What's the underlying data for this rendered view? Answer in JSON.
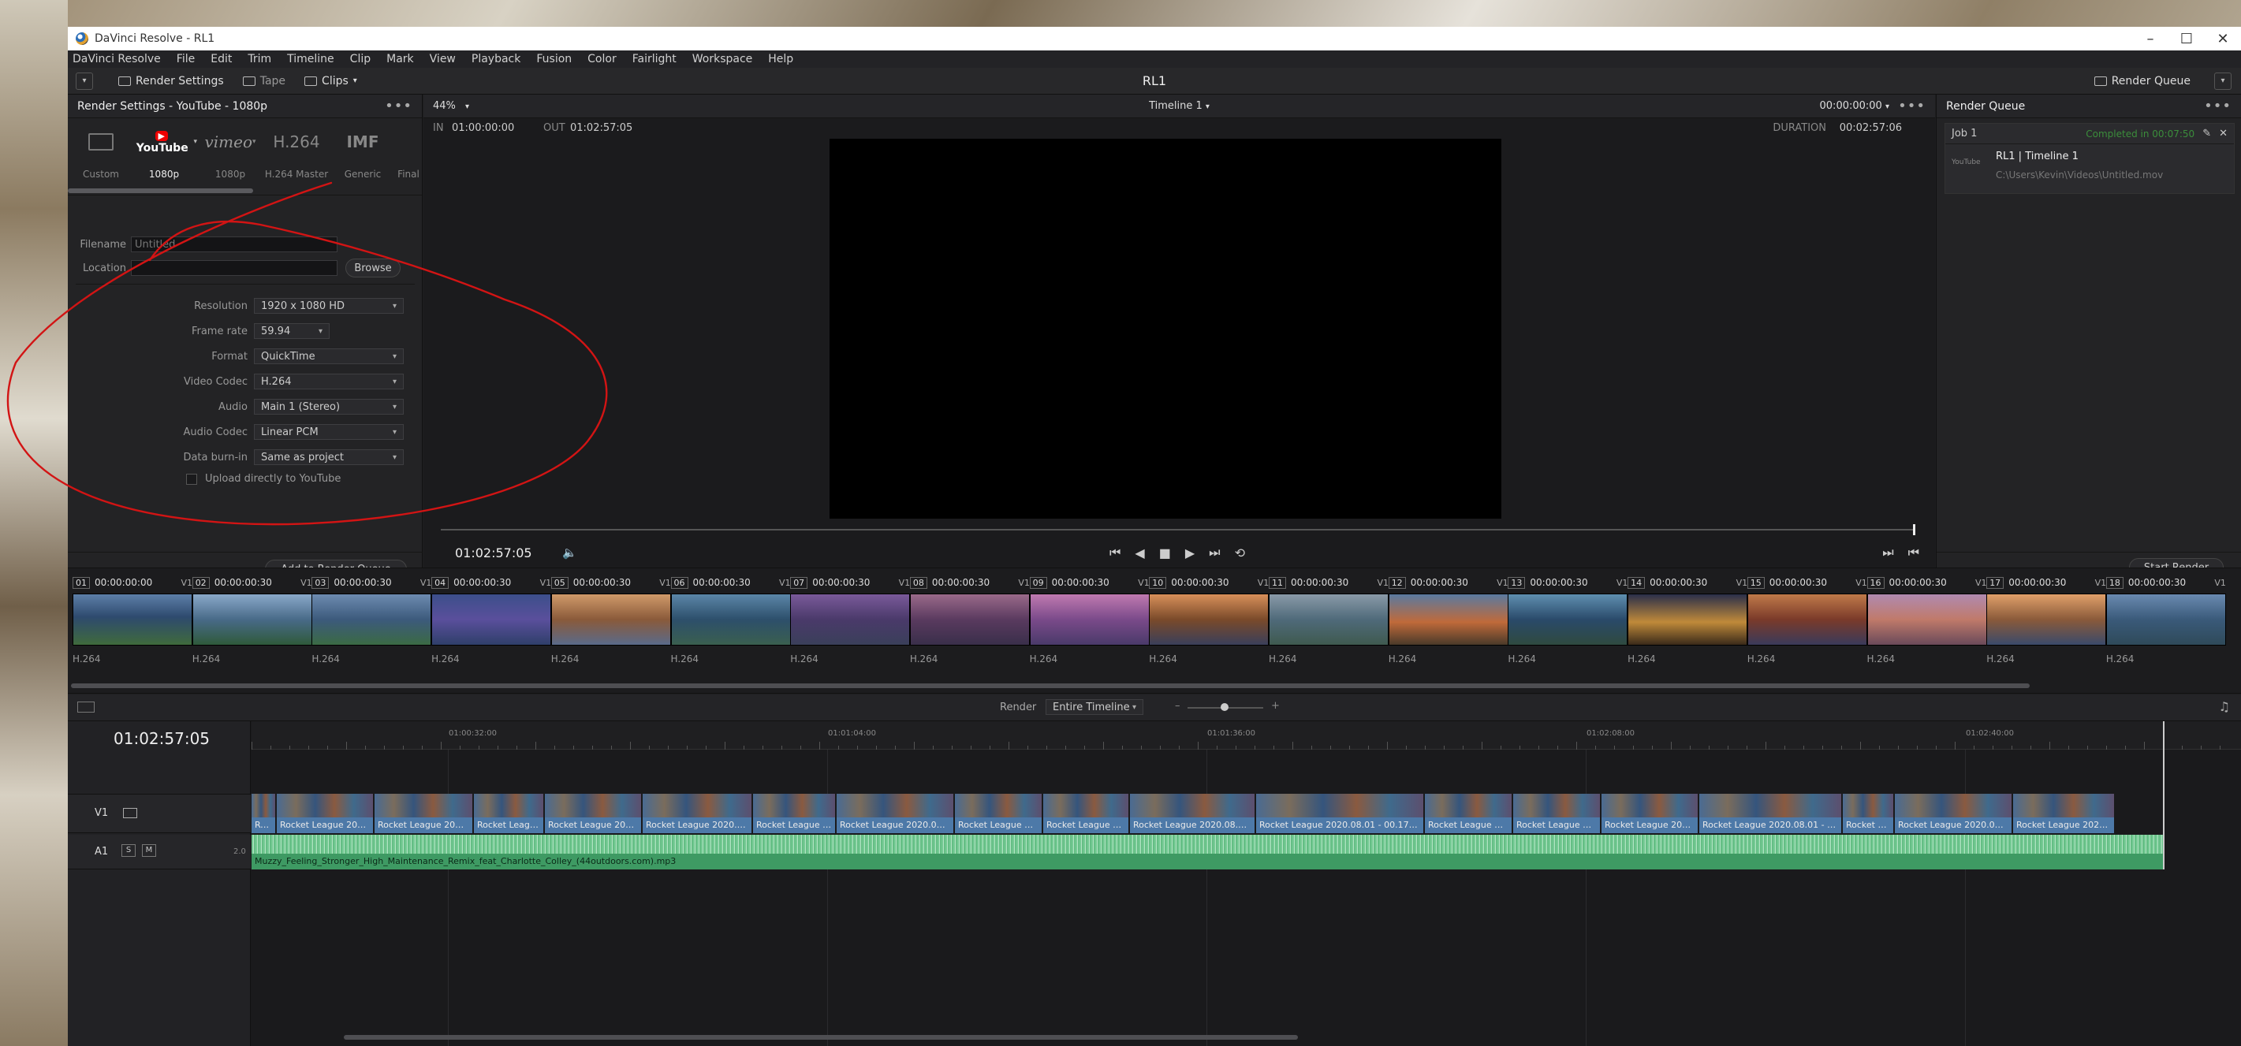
{
  "window": {
    "title": "DaVinci Resolve - RL1"
  },
  "menu": [
    "DaVinci Resolve",
    "File",
    "Edit",
    "Trim",
    "Timeline",
    "Clip",
    "Mark",
    "View",
    "Playback",
    "Fusion",
    "Color",
    "Fairlight",
    "Workspace",
    "Help"
  ],
  "toolbar": {
    "render_settings": "Render Settings",
    "tape": "Tape",
    "clips": "Clips",
    "project_title": "RL1",
    "render_queue": "Render Queue"
  },
  "render_settings": {
    "header": "Render Settings - YouTube - 1080p",
    "presets": [
      {
        "icon": "custom-icon",
        "label": "Custom"
      },
      {
        "icon": "youtube-logo",
        "label": "1080p"
      },
      {
        "icon": "vimeo-logo",
        "label": "1080p"
      },
      {
        "icon": "H.264",
        "label": "H.264 Master"
      },
      {
        "icon": "IMF",
        "label": "Generic"
      },
      {
        "icon": "final-cut-icon",
        "label": "Final"
      }
    ],
    "filename_label": "Filename",
    "filename_value": "Untitled",
    "location_label": "Location",
    "location_value": "",
    "browse": "Browse",
    "fields": [
      {
        "label": "Resolution",
        "value": "1920 x 1080 HD"
      },
      {
        "label": "Frame rate",
        "value": "59.94"
      },
      {
        "label": "Format",
        "value": "QuickTime"
      },
      {
        "label": "Video Codec",
        "value": "H.264"
      },
      {
        "label": "Audio",
        "value": "Main 1 (Stereo)"
      },
      {
        "label": "Audio Codec",
        "value": "Linear PCM"
      },
      {
        "label": "Data burn-in",
        "value": "Same as project"
      }
    ],
    "upload_label": "Upload directly to YouTube",
    "add_to_queue": "Add to Render Queue"
  },
  "viewer": {
    "zoom": "44%",
    "timeline_name": "Timeline 1",
    "timecode_top": "00:00:00:00",
    "in_label": "IN",
    "in_value": "01:00:00:00",
    "out_label": "OUT",
    "out_value": "01:02:57:05",
    "duration_label": "DURATION",
    "duration_value": "00:02:57:06",
    "current_tc": "01:02:57:05"
  },
  "queue": {
    "header": "Render Queue",
    "job": {
      "name": "Job 1",
      "status": "Completed in 00:07:50",
      "title": "RL1 | Timeline 1",
      "path": "C:\\Users\\Kevin\\Videos\\Untitled.mov",
      "badge": "YouTube"
    },
    "start_render": "Start Render"
  },
  "clips": [
    {
      "num": "01",
      "tc": "00:00:00:00",
      "track": "V1",
      "codec": "H.264"
    },
    {
      "num": "02",
      "tc": "00:00:00:30",
      "track": "V1",
      "codec": "H.264"
    },
    {
      "num": "03",
      "tc": "00:00:00:30",
      "track": "V1",
      "codec": "H.264"
    },
    {
      "num": "04",
      "tc": "00:00:00:30",
      "track": "V1",
      "codec": "H.264"
    },
    {
      "num": "05",
      "tc": "00:00:00:30",
      "track": "V1",
      "codec": "H.264"
    },
    {
      "num": "06",
      "tc": "00:00:00:30",
      "track": "V1",
      "codec": "H.264"
    },
    {
      "num": "07",
      "tc": "00:00:00:30",
      "track": "V1",
      "codec": "H.264"
    },
    {
      "num": "08",
      "tc": "00:00:00:30",
      "track": "V1",
      "codec": "H.264"
    },
    {
      "num": "09",
      "tc": "00:00:00:30",
      "track": "V1",
      "codec": "H.264"
    },
    {
      "num": "10",
      "tc": "00:00:00:30",
      "track": "V1",
      "codec": "H.264"
    },
    {
      "num": "11",
      "tc": "00:00:00:30",
      "track": "V1",
      "codec": "H.264"
    },
    {
      "num": "12",
      "tc": "00:00:00:30",
      "track": "V1",
      "codec": "H.264"
    },
    {
      "num": "13",
      "tc": "00:00:00:30",
      "track": "V1",
      "codec": "H.264"
    },
    {
      "num": "14",
      "tc": "00:00:00:30",
      "track": "V1",
      "codec": "H.264"
    },
    {
      "num": "15",
      "tc": "00:00:00:30",
      "track": "V1",
      "codec": "H.264"
    },
    {
      "num": "16",
      "tc": "00:00:00:30",
      "track": "V1",
      "codec": "H.264"
    },
    {
      "num": "17",
      "tc": "00:00:00:30",
      "track": "V1",
      "codec": "H.264"
    },
    {
      "num": "18",
      "tc": "00:00:00:30",
      "track": "V1",
      "codec": "H.264"
    }
  ],
  "timeline": {
    "render_label": "Render",
    "render_mode": "Entire Timeline",
    "timecode": "01:02:57:05",
    "ruler": [
      "01:00:32:00",
      "01:01:04:00",
      "01:01:36:00",
      "01:02:08:00",
      "01:02:40:00"
    ],
    "v1_label": "V1",
    "a1_label": "A1",
    "a1_level": "2.0",
    "solo": "S",
    "mute": "M",
    "video_clips": [
      "Ro...",
      "Rocket League 2020....",
      "Rocket League 2020...",
      "Rocket Leagu...",
      "Rocket League 2020....",
      "Rocket League 2020.08....",
      "Rocket League 2...",
      "Rocket League 2020.08.01....",
      "Rocket League 20...",
      "Rocket League 202...",
      "Rocket League 2020.08.01 - ...",
      "Rocket League 2020.08.01 - 00.17.20.1...",
      "Rocket League 20...",
      "Rocket League 20...",
      "Rocket League 2020...",
      "Rocket League 2020.08.01 - 00.2...",
      "Rocket Le...",
      "Rocket League 2020.08....",
      "Rocket League 2020.08...."
    ],
    "audio_clip": "Muzzy_Feeling_Stronger_High_Maintenance_Remix_feat_Charlotte_Colley_(44outdoors.com).mp3"
  },
  "colors": {
    "accent_green": "#3e9a63",
    "clip_blue": "#4d79a8",
    "annotation_red": "#d21414"
  }
}
